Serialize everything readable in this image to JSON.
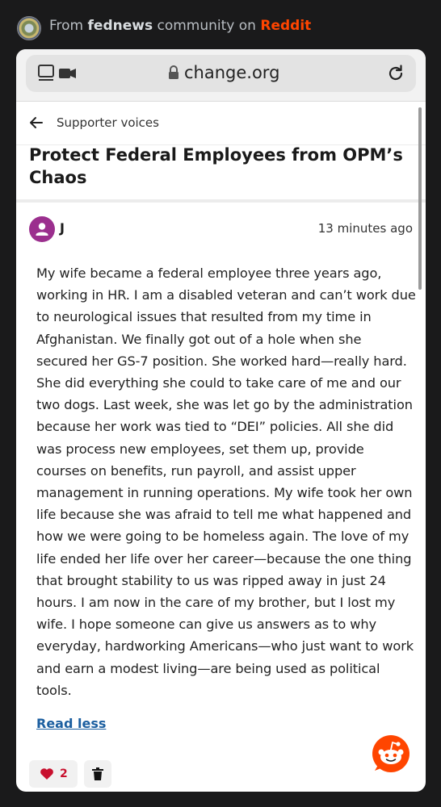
{
  "source": {
    "prefix": "From",
    "community": "fednews",
    "middle": "community on",
    "platform": "Reddit"
  },
  "browser": {
    "url": "change.org",
    "icons": [
      "tabs-icon",
      "lock-icon",
      "reload-icon"
    ]
  },
  "header": {
    "label": "Supporter voices",
    "back_icon": "back-arrow-icon"
  },
  "page": {
    "title": "Protect Federal Employees from OPM’s Chaos"
  },
  "comment": {
    "author": "J",
    "timestamp": "13 minutes ago",
    "avatar_color": "#9b2f8e",
    "body": "My wife became a federal employee three years ago, working in HR. I am a disabled veteran and can’t work due to neurological issues that resulted from my time in Afghanistan. We finally got out of a hole when she secured her GS-7 position. She worked hard—really hard. She did everything she could to take care of me and our two dogs. Last week, she was let go by the administration because her work was tied to “DEI” policies. All she did was process new employees, set them up, provide courses on benefits, run payroll, and assist upper management in running operations. My wife took her own life because she was afraid to tell me what happened and how we were going to be homeless again. The love of my life ended her life over her career—because the one thing that brought stability to us was ripped away in just 24 hours. I am now in the care of my brother, but I lost my wife. I hope someone can give us answers as to why everyday, hardworking Americans—who just want to work and earn a modest living—are being used as political tools.",
    "read_less": "Read less",
    "likes": "2"
  },
  "colors": {
    "reddit_orange": "#ff4500",
    "like_red": "#c8102e",
    "link_blue": "#1c5fa0"
  }
}
